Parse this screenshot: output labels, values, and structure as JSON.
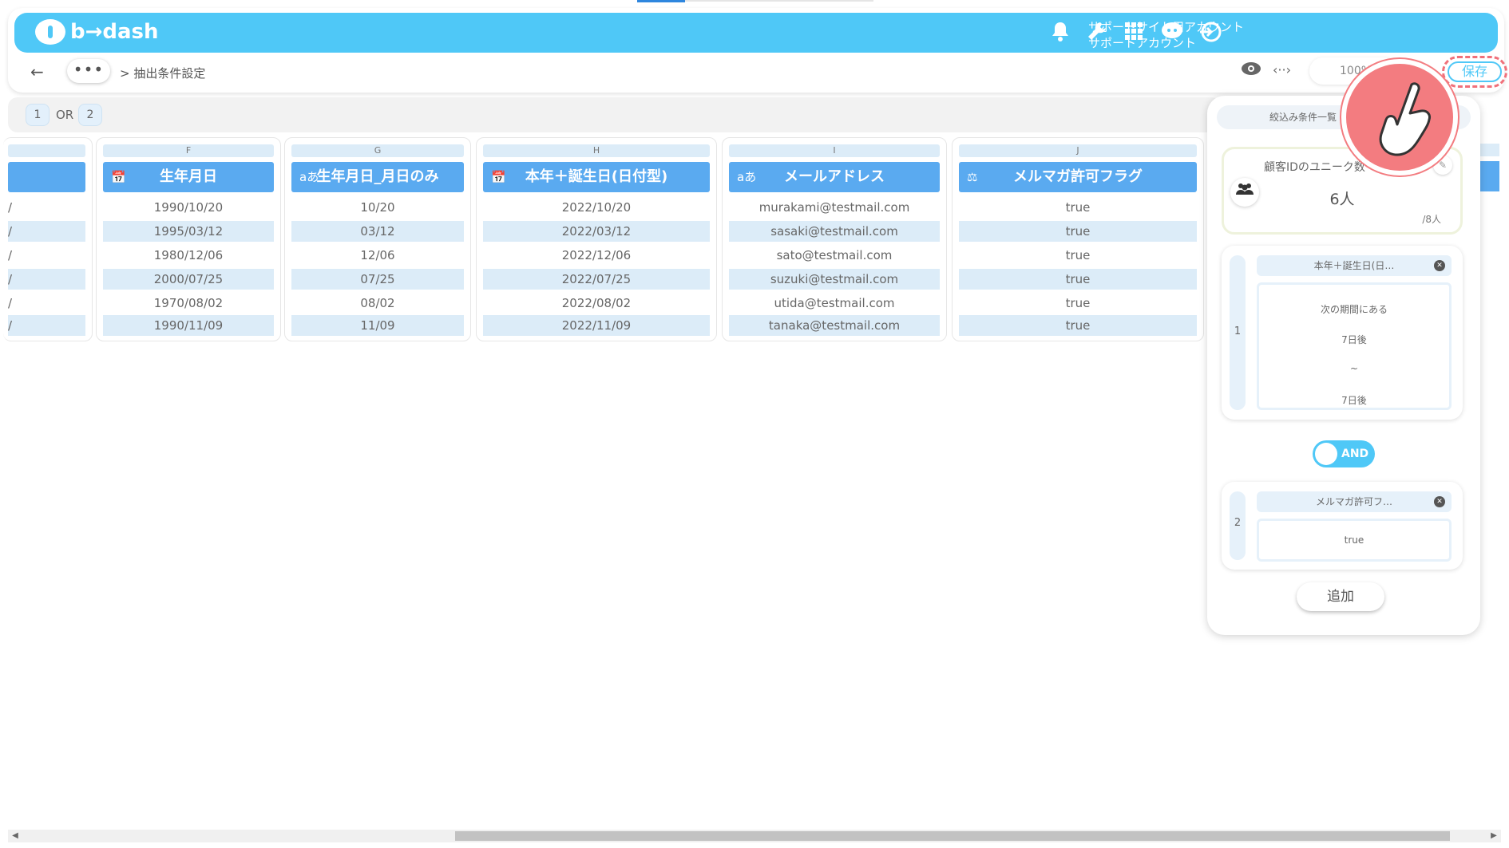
{
  "header": {
    "logo_text": "b→dash",
    "account_line1": "サポートサイト用アカウント",
    "account_line2": "サポートアカウント",
    "icons": [
      "bell-icon",
      "wrench-icon",
      "apps-grid-icon",
      "support-chat-icon",
      "logout-icon"
    ]
  },
  "toolbar": {
    "back_icon": "←",
    "more_label": "•••",
    "breadcrumb": "> 抽出条件設定",
    "zoom": "100%",
    "save_label": "保存"
  },
  "or_bar": {
    "left_num": "1",
    "or_label": "OR",
    "right_num": "2"
  },
  "columns": [
    {
      "letter": "F",
      "title": "生年月日",
      "icon": "📅",
      "rows": [
        "1990/10/20",
        "1995/03/12",
        "1980/12/06",
        "2000/07/25",
        "1970/08/02",
        "1990/11/09"
      ]
    },
    {
      "letter": "G",
      "title": "生年月日_月日のみ",
      "icon": "aあ",
      "rows": [
        "10/20",
        "03/12",
        "12/06",
        "07/25",
        "08/02",
        "11/09"
      ]
    },
    {
      "letter": "H",
      "title": "本年＋誕生日(日付型)",
      "icon": "📅",
      "rows": [
        "2022/10/20",
        "2022/03/12",
        "2022/12/06",
        "2022/07/25",
        "2022/08/02",
        "2022/11/09"
      ]
    },
    {
      "letter": "I",
      "title": "メールアドレス",
      "icon": "aあ",
      "rows": [
        "murakami@testmail.com",
        "sasaki@testmail.com",
        "sato@testmail.com",
        "suzuki@testmail.com",
        "utida@testmail.com",
        "tanaka@testmail.com"
      ]
    },
    {
      "letter": "J",
      "title": "メルマガ許可フラグ",
      "icon": "⚖",
      "rows": [
        "true",
        "true",
        "true",
        "true",
        "true",
        "true"
      ]
    }
  ],
  "partial_left_rows": [
    "/",
    "/",
    "/",
    "/",
    "/",
    "/"
  ],
  "panel": {
    "title": "絞込み条件一覧",
    "unique": {
      "title": "顧客IDのユニーク数",
      "count": "6人",
      "total": "/8人"
    },
    "conditions": [
      {
        "index": "1",
        "column": "本年＋誕生日(日…",
        "lines": [
          "次の期間にある",
          "7日後",
          "~",
          "7日後"
        ]
      },
      {
        "index": "2",
        "column": "メルマガ許可フ…",
        "lines": [
          "true"
        ]
      }
    ],
    "and_label": "AND",
    "add_label": "追加"
  },
  "colors": {
    "brand": "#4fc8f7",
    "column_header": "#5aaaf0",
    "row_stripe": "#dcecf8",
    "highlight": "#f37c80"
  }
}
